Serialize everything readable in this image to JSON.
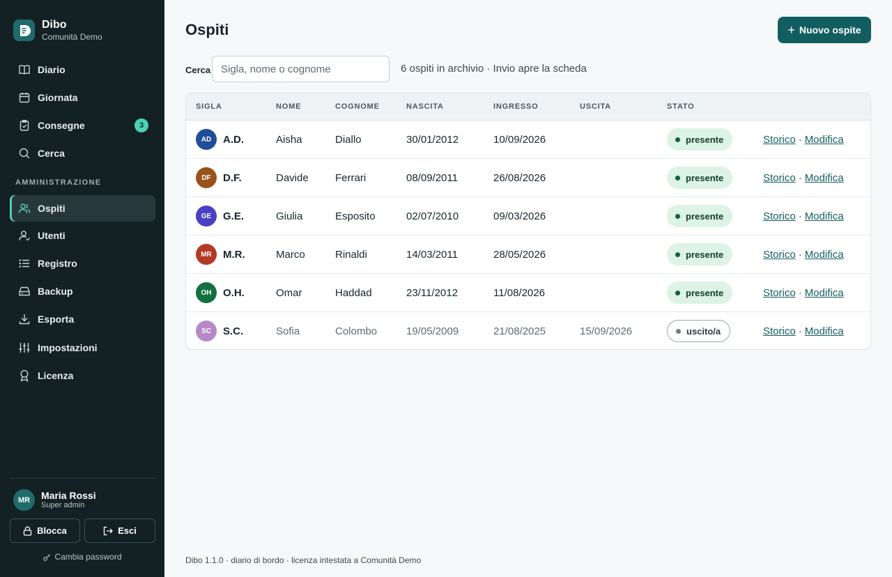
{
  "brand": {
    "name": "Dibo",
    "subtitle": "Comunità Demo"
  },
  "nav": {
    "items": [
      {
        "label": "Diario",
        "icon": "book-icon"
      },
      {
        "label": "Giornata",
        "icon": "calendar-icon"
      },
      {
        "label": "Consegne",
        "icon": "clipboard-icon",
        "badge": "3"
      },
      {
        "label": "Cerca",
        "icon": "search-icon"
      }
    ],
    "section_label": "AMMINISTRAZIONE",
    "admin_items": [
      {
        "label": "Ospiti",
        "icon": "users-icon",
        "active": true
      },
      {
        "label": "Utenti",
        "icon": "user-icon"
      },
      {
        "label": "Registro",
        "icon": "list-icon"
      },
      {
        "label": "Backup",
        "icon": "archive-icon"
      },
      {
        "label": "Esporta",
        "icon": "download-icon"
      },
      {
        "label": "Impostazioni",
        "icon": "sliders-icon"
      },
      {
        "label": "Licenza",
        "icon": "award-icon"
      }
    ]
  },
  "user": {
    "initials": "MR",
    "name": "Maria Rossi",
    "role": "Super admin"
  },
  "side_actions": {
    "lock_label": "Blocca",
    "logout_label": "Esci",
    "password_label": "Cambia password"
  },
  "page": {
    "title": "Ospiti",
    "new_button": "Nuovo ospite"
  },
  "search": {
    "label": "Cerca",
    "placeholder": "Sigla, nome o cognome",
    "count_text": "6 ospiti in archivio · Invio apre la scheda"
  },
  "table": {
    "headers": [
      "SIGLA",
      "NOME",
      "COGNOME",
      "NASCITA",
      "INGRESSO",
      "USCITA",
      "STATO"
    ],
    "history_label": "Storico",
    "edit_label": "Modifica",
    "rows": [
      {
        "initials": "AD",
        "sigla": "A.D.",
        "avatar_color": "#1f4e9a",
        "nome": "Aisha",
        "cognome": "Diallo",
        "nascita": "30/01/2012",
        "ingresso": "10/09/2026",
        "uscita": "",
        "stato": "presente",
        "status_type": "present"
      },
      {
        "initials": "DF",
        "sigla": "D.F.",
        "avatar_color": "#9a521c",
        "nome": "Davide",
        "cognome": "Ferrari",
        "nascita": "08/09/2011",
        "ingresso": "26/08/2026",
        "uscita": "",
        "stato": "presente",
        "status_type": "present"
      },
      {
        "initials": "GE",
        "sigla": "G.E.",
        "avatar_color": "#4a3fc4",
        "nome": "Giulia",
        "cognome": "Esposito",
        "nascita": "02/07/2010",
        "ingresso": "09/03/2026",
        "uscita": "",
        "stato": "presente",
        "status_type": "present"
      },
      {
        "initials": "MR",
        "sigla": "M.R.",
        "avatar_color": "#b23a25",
        "nome": "Marco",
        "cognome": "Rinaldi",
        "nascita": "14/03/2011",
        "ingresso": "28/05/2026",
        "uscita": "",
        "stato": "presente",
        "status_type": "present"
      },
      {
        "initials": "OH",
        "sigla": "O.H.",
        "avatar_color": "#13713f",
        "nome": "Omar",
        "cognome": "Haddad",
        "nascita": "23/11/2012",
        "ingresso": "11/08/2026",
        "uscita": "",
        "stato": "presente",
        "status_type": "present"
      },
      {
        "initials": "SC",
        "sigla": "S.C.",
        "avatar_color": "#b888c6",
        "nome": "Sofia",
        "cognome": "Colombo",
        "nascita": "19/05/2009",
        "ingresso": "21/08/2025",
        "uscita": "15/09/2026",
        "stato": "uscito/a",
        "status_type": "out"
      }
    ]
  },
  "footer": {
    "text": "Dibo 1.1.0 · diario di bordo · licenza intestata a Comunità Demo"
  }
}
